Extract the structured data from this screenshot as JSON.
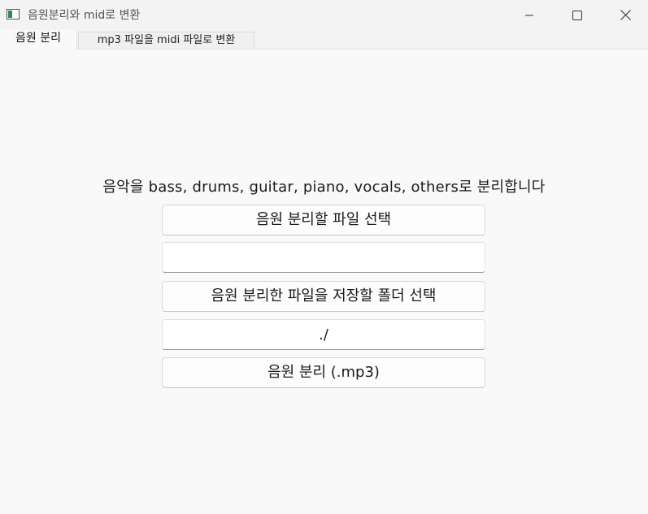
{
  "window": {
    "title": "음원분리와 mid로 변환",
    "icon": "app-window-icon",
    "controls": [
      "minimize-icon",
      "maximize-icon",
      "close-icon"
    ]
  },
  "tabs": [
    {
      "label": "음원 분리",
      "active": true
    },
    {
      "label": "mp3 파일을 midi 파일로 변환",
      "active": false
    }
  ],
  "main": {
    "description": "음악을 bass, drums, guitar, piano, vocals, others로 분리합니다",
    "select_file_button": "음원 분리할 파일 선택",
    "selected_file_value": "",
    "select_folder_button": "음원 분리한 파일을 저장할 폴더 선택",
    "output_folder_value": "./",
    "separate_button": "음원 분리 (.mp3)"
  }
}
